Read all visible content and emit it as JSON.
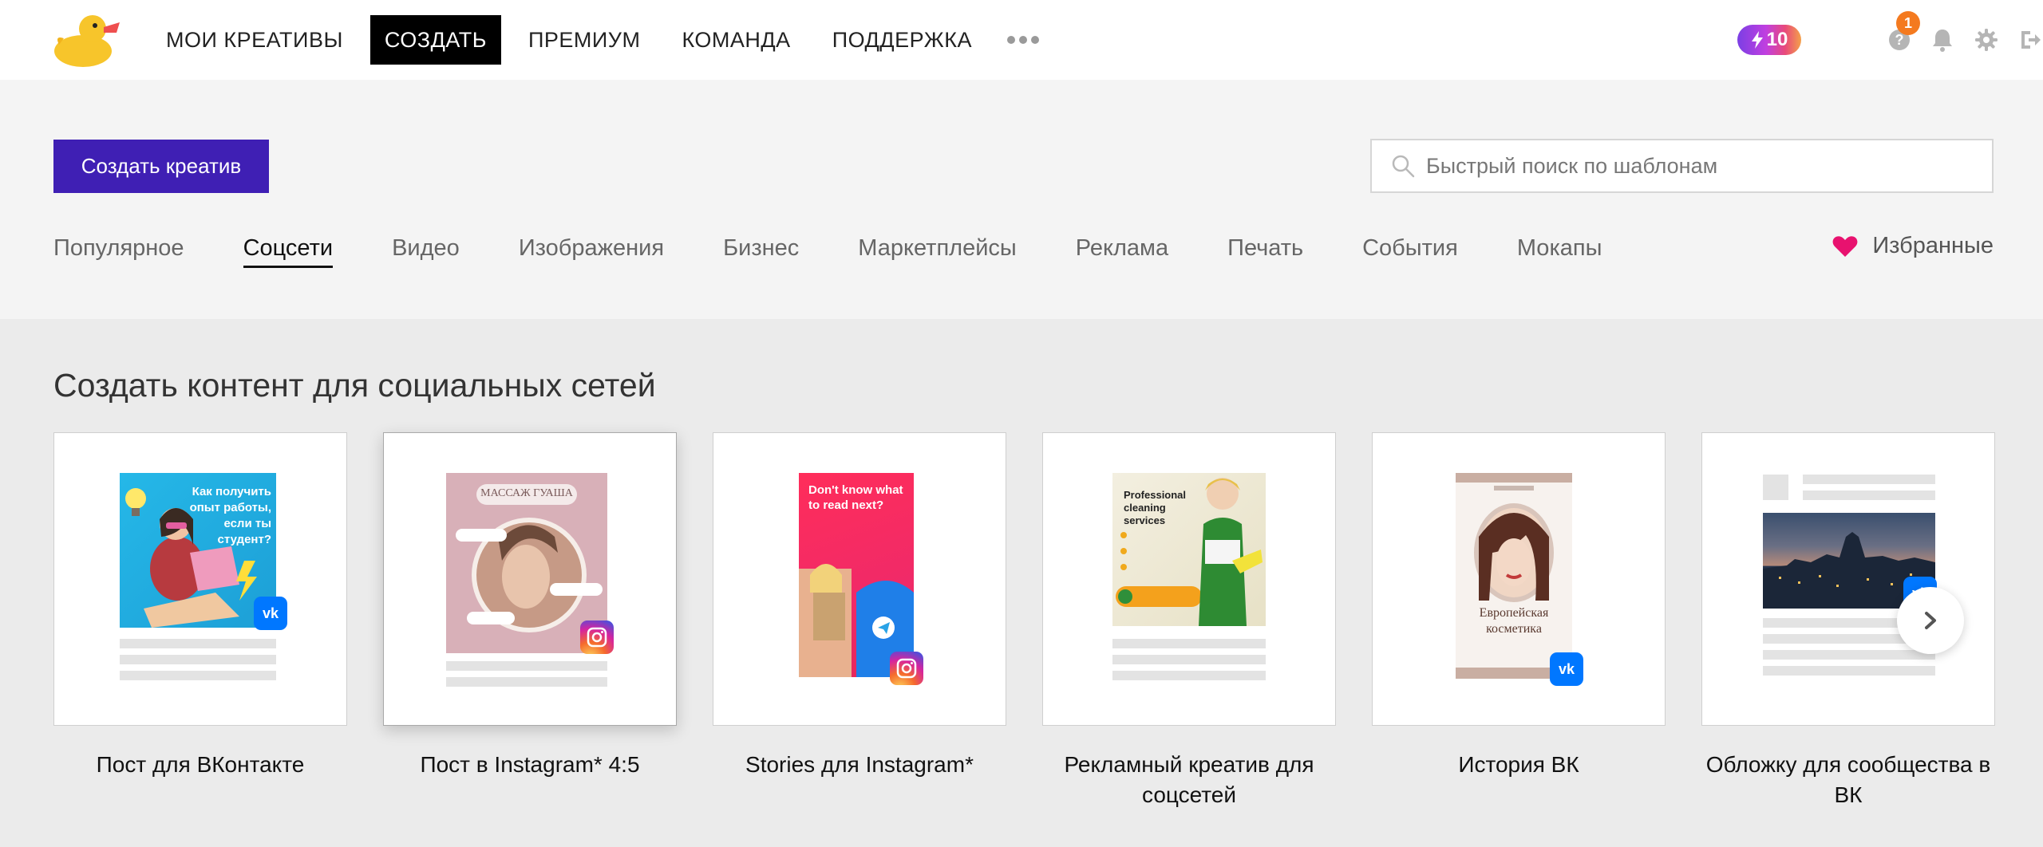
{
  "nav": {
    "items": [
      {
        "label": "МОИ КРЕАТИВЫ",
        "active": false
      },
      {
        "label": "СОЗДАТЬ",
        "active": true
      },
      {
        "label": "ПРЕМИУМ",
        "active": false
      },
      {
        "label": "КОМАНДА",
        "active": false
      },
      {
        "label": "ПОДДЕРЖКА",
        "active": false
      }
    ],
    "more_icon": "ellipsis-icon"
  },
  "header": {
    "credits": "10",
    "notifications_count": "1",
    "icons": [
      "bolt-icon",
      "help-icon",
      "bell-icon",
      "gear-icon",
      "logout-icon"
    ]
  },
  "toolbar": {
    "create_label": "Создать креатив",
    "search_placeholder": "Быстрый поиск по шаблонам"
  },
  "categories": [
    {
      "label": "Популярное",
      "active": false
    },
    {
      "label": "Соцсети",
      "active": true
    },
    {
      "label": "Видео",
      "active": false
    },
    {
      "label": "Изображения",
      "active": false
    },
    {
      "label": "Бизнес",
      "active": false
    },
    {
      "label": "Маркетплейсы",
      "active": false
    },
    {
      "label": "Реклама",
      "active": false
    },
    {
      "label": "Печать",
      "active": false
    },
    {
      "label": "События",
      "active": false
    },
    {
      "label": "Мокапы",
      "active": false
    }
  ],
  "favorites_label": "Избранные",
  "section": {
    "title": "Создать контент для социальных сетей",
    "cards": [
      {
        "label": "Пост для ВКонтакте",
        "network": "vk",
        "thumb_text": "Как получить опыт работы, если ты студент?"
      },
      {
        "label": "Пост в Instagram* 4:5",
        "network": "instagram",
        "thumb_text": "МАССАЖ ГУАША"
      },
      {
        "label": "Stories для Instagram*",
        "network": "instagram",
        "thumb_text": "Don't know what to read next?"
      },
      {
        "label": "Рекламный креатив для соцсетей",
        "network": "",
        "thumb_text": "Professional cleaning services"
      },
      {
        "label": "История ВК",
        "network": "vk",
        "thumb_text": "Европейская косметика"
      },
      {
        "label": "Обложку для сообщества в ВК",
        "network": "vk",
        "thumb_text": ""
      }
    ]
  },
  "colors": {
    "brand": "#3f1fb4",
    "vk": "#0077ff",
    "badge": "#f47a1f",
    "heart": "#e8126f"
  }
}
